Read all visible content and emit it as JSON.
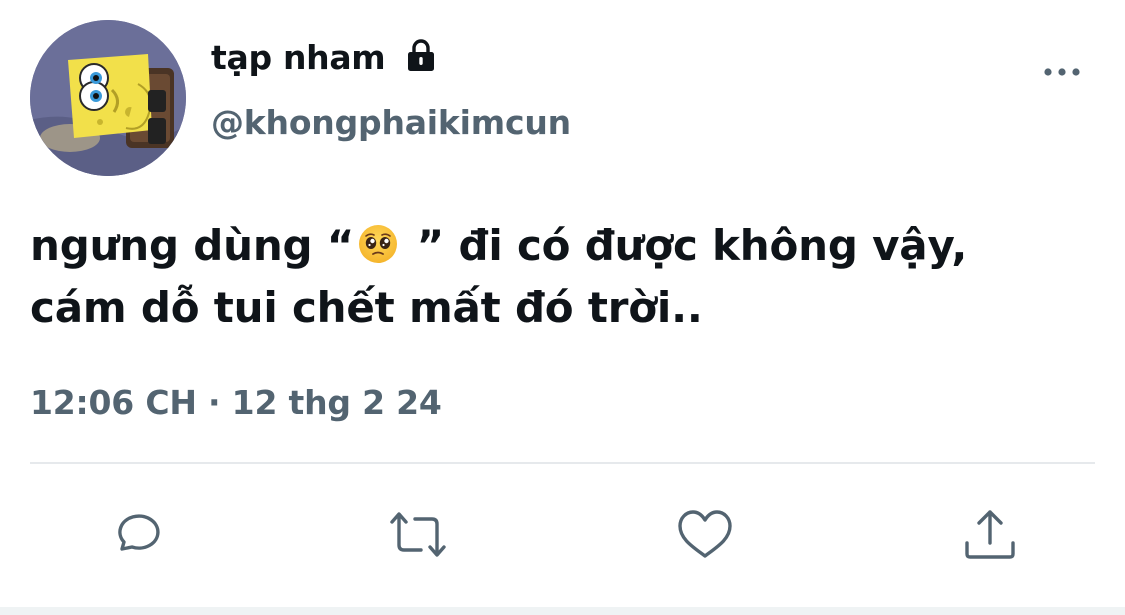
{
  "user": {
    "display_name": "tạp nham",
    "handle": "@khongphaikimcun",
    "protected_icon": "lock-icon",
    "avatar_icon": "spongebob-avatar"
  },
  "tweet": {
    "line1_before": "ngưng dùng “",
    "emoji": "pleading-face-emoji",
    "line1_after": " ” đi có được không vậy,",
    "line2": "cám dỗ tui chết mất đó trời..",
    "timestamp": "12:06 CH · 12 thg 2 24"
  },
  "actions": [
    {
      "name": "reply",
      "icon": "reply-icon"
    },
    {
      "name": "retweet",
      "icon": "retweet-icon"
    },
    {
      "name": "like",
      "icon": "heart-icon"
    },
    {
      "name": "share",
      "icon": "share-icon"
    }
  ],
  "colors": {
    "text_primary": "#0f1419",
    "text_secondary": "#536471",
    "icon": "#536471",
    "divider": "#e6e9ec"
  }
}
